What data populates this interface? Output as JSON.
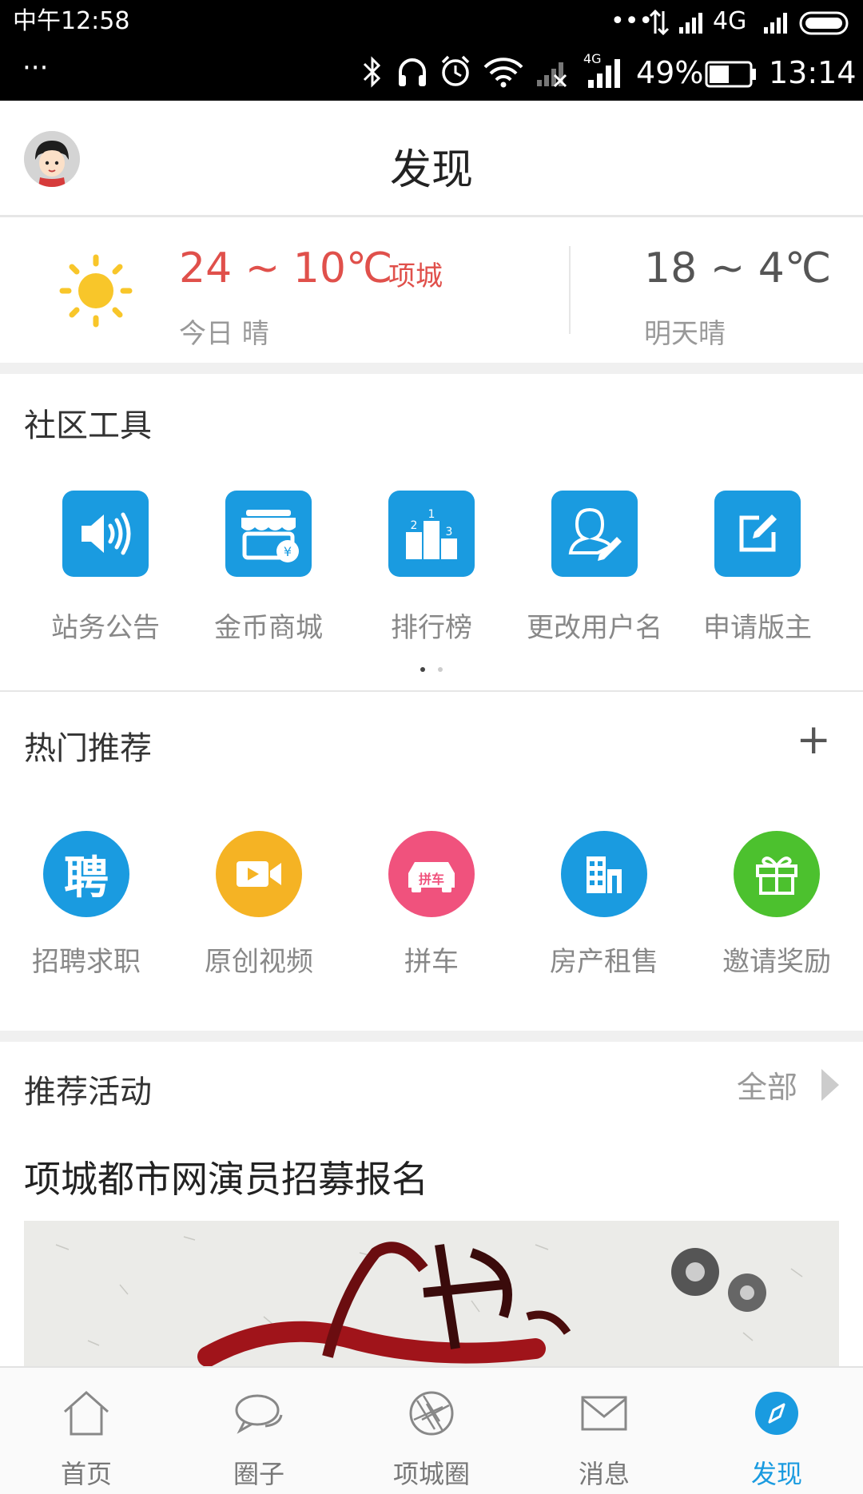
{
  "status_bar": {
    "carrier_time": "中午12:58",
    "network_1": "4G",
    "network_2": "4G",
    "battery": "49%",
    "time": "13:14",
    "menu_dots": "···"
  },
  "header": {
    "title": "发现"
  },
  "weather": {
    "today_range": "24 ~ 10℃",
    "city": "项城",
    "today_desc": "今日 晴",
    "tomorrow_range": "18 ~ 4℃",
    "tomorrow_desc": "明天晴"
  },
  "tools": {
    "title": "社区工具",
    "items": [
      {
        "label": "站务公告",
        "icon": "speaker-icon"
      },
      {
        "label": "金币商城",
        "icon": "shop-icon"
      },
      {
        "label": "排行榜",
        "icon": "podium-icon"
      },
      {
        "label": "更改用户名",
        "icon": "edit-user-icon"
      },
      {
        "label": "申请版主",
        "icon": "edit-icon"
      }
    ],
    "page_count": 2,
    "active_page": 1
  },
  "hot": {
    "title": "热门推荐",
    "add_label": "+",
    "items": [
      {
        "label": "招聘求职",
        "icon": "recruit-icon",
        "color": "#1a9be0",
        "glyph": "聘"
      },
      {
        "label": "原创视频",
        "icon": "video-icon",
        "color": "#f5b324"
      },
      {
        "label": "拼车",
        "icon": "carpool-icon",
        "color": "#f0527d",
        "glyph": "拼车"
      },
      {
        "label": "房产租售",
        "icon": "building-icon",
        "color": "#1a9be0"
      },
      {
        "label": "邀请奖励",
        "icon": "gift-icon",
        "color": "#4cc12e"
      }
    ]
  },
  "activity": {
    "title": "推荐活动",
    "all_label": "全部",
    "headline": "项城都市网演员招募报名"
  },
  "tabbar": {
    "items": [
      {
        "label": "首页",
        "icon": "home-icon"
      },
      {
        "label": "圈子",
        "icon": "chat-icon"
      },
      {
        "label": "项城圈",
        "icon": "aperture-icon"
      },
      {
        "label": "消息",
        "icon": "mail-icon"
      },
      {
        "label": "发现",
        "icon": "compass-icon"
      }
    ],
    "active": 4
  },
  "colors": {
    "accent": "#1a9be0",
    "weather_red": "#e0504b"
  }
}
